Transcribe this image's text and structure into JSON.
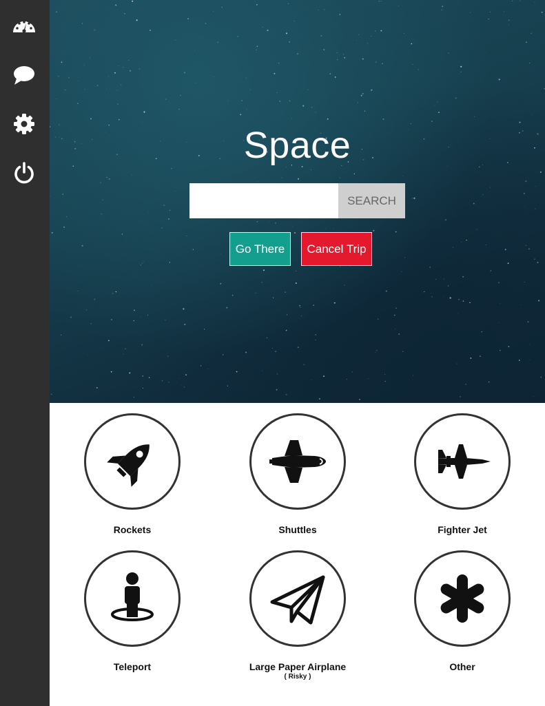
{
  "sidebar": {
    "items": [
      {
        "icon": "dashboard-icon"
      },
      {
        "icon": "chat-icon"
      },
      {
        "icon": "gear-icon"
      },
      {
        "icon": "power-icon"
      }
    ]
  },
  "hero": {
    "title": "Space",
    "search": {
      "value": "",
      "placeholder": "",
      "button_label": "SEARCH"
    },
    "go_label": "Go There",
    "cancel_label": "Cancel Trip"
  },
  "options": [
    {
      "label": "Rockets",
      "icon": "rocket-icon"
    },
    {
      "label": "Shuttles",
      "icon": "shuttle-icon"
    },
    {
      "label": "Fighter Jet",
      "icon": "fighter-jet-icon"
    },
    {
      "label": "Teleport",
      "icon": "teleport-icon"
    },
    {
      "label": "Large Paper Airplane",
      "sublabel": "( Risky )",
      "icon": "paper-airplane-icon"
    },
    {
      "label": "Other",
      "icon": "asterisk-icon"
    }
  ],
  "colors": {
    "sidebar": "#2f2f2f",
    "go_button": "#139e8e",
    "cancel_button": "#e5192e",
    "search_button": "#cfcfcf"
  }
}
